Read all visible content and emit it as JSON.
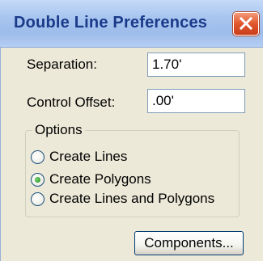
{
  "window": {
    "title": "Double Line Preferences"
  },
  "fields": {
    "separation": {
      "label": "Separation:",
      "value": "1.70'"
    },
    "control_offset": {
      "label": "Control Offset:",
      "value": ".00'"
    }
  },
  "options": {
    "legend": "Options",
    "items": [
      {
        "label": "Create Lines",
        "selected": false
      },
      {
        "label": "Create Polygons",
        "selected": true
      },
      {
        "label": "Create Lines and Polygons",
        "selected": false
      }
    ]
  },
  "buttons": {
    "components": "Components..."
  },
  "colors": {
    "title_text": "#1a3a8a",
    "close_button": "#e2572d",
    "dialog_face": "#ece9d8",
    "radio_dot": "#2f9b2a"
  }
}
